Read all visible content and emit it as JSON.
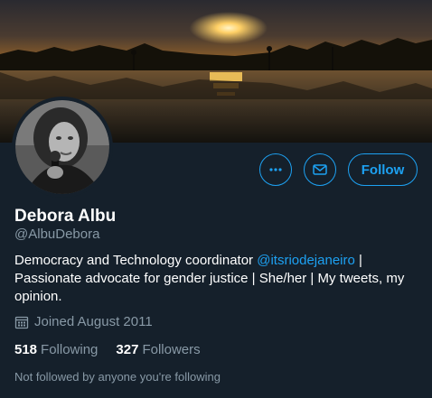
{
  "profile": {
    "name": "Debora Albu",
    "handle": "@AlbuDebora",
    "bio_prefix": "Democracy and Technology coordinator ",
    "bio_mention": "@itsriodejaneiro",
    "bio_suffix": " | Passionate advocate for gender justice | She/her | My tweets, my opinion.",
    "joined": "Joined August 2011",
    "following_count": "518",
    "following_label": "Following",
    "followers_count": "327",
    "followers_label": "Followers",
    "not_followed_text": "Not followed by anyone you're following"
  },
  "actions": {
    "more_icon": "more-icon",
    "message_icon": "envelope-icon",
    "follow_label": "Follow"
  },
  "colors": {
    "background": "#15202b",
    "accent": "#1da1f2",
    "secondary_text": "#8899a6",
    "primary_text": "#ffffff"
  }
}
